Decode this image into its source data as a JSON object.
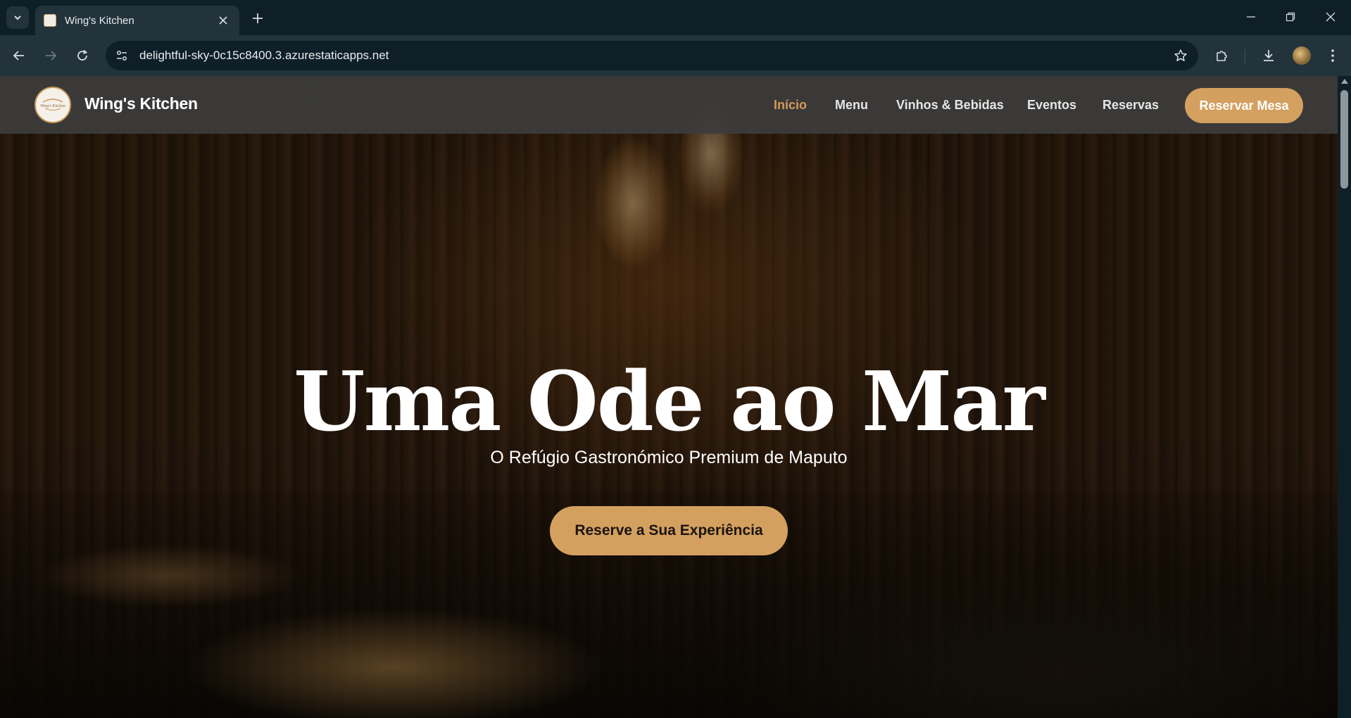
{
  "browser": {
    "tab_title": "Wing's Kitchen",
    "url": "delightful-sky-0c15c8400.3.azurestaticapps.net",
    "icons": {
      "tab_search": "chevron-down-icon",
      "close_tab": "close-icon",
      "new_tab": "plus-icon",
      "minimize": "minimize-icon",
      "restore": "restore-icon",
      "close_window": "close-icon",
      "back": "arrow-left-icon",
      "forward": "arrow-right-icon",
      "reload": "reload-icon",
      "site_info": "tune-icon",
      "bookmark": "star-icon",
      "extensions": "puzzle-icon",
      "downloads": "download-icon",
      "menu": "more-vert-icon"
    }
  },
  "site": {
    "brand": "Wing's Kitchen",
    "logo_text": "Wing's Kitchen",
    "nav": [
      {
        "label": "Início",
        "active": true
      },
      {
        "label": "Menu",
        "active": false
      },
      {
        "label": "Vinhos & Bebidas",
        "active": false
      },
      {
        "label": "Eventos",
        "active": false
      },
      {
        "label": "Reservas",
        "active": false
      }
    ],
    "nav_cta": "Reservar Mesa"
  },
  "hero": {
    "title": "Uma Ode ao Mar",
    "subtitle": "O Refúgio Gastronómico Premium de Maputo",
    "cta": "Reserve a Sua Experiência"
  },
  "colors": {
    "accent": "#d4a05f",
    "active_link": "#d49a5a",
    "header_bg": "#3c3c3c",
    "chrome_bg": "#0f1f27",
    "toolbar_bg": "#22333b"
  }
}
